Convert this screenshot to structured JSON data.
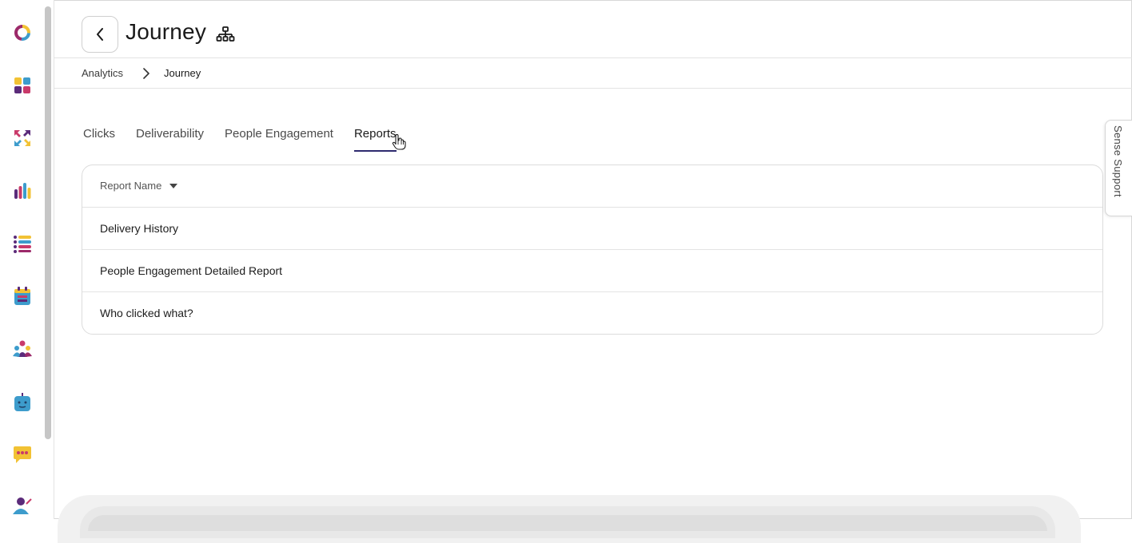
{
  "header": {
    "title": "Journey"
  },
  "breadcrumb": {
    "items": [
      "Analytics",
      "Journey"
    ]
  },
  "tabs": [
    {
      "label": "Clicks",
      "active": false
    },
    {
      "label": "Deliverability",
      "active": false
    },
    {
      "label": "People Engagement",
      "active": false
    },
    {
      "label": "Reports",
      "active": true
    }
  ],
  "table": {
    "column_header": "Report Name",
    "rows": [
      "Delivery History",
      "People Engagement Detailed Report",
      "Who clicked what?"
    ]
  },
  "support_tab": {
    "label": "Sense Support"
  },
  "sidebar": {
    "icons": [
      "logo-icon",
      "dashboard-icon",
      "integrations-icon",
      "analytics-icon",
      "lists-icon",
      "calendar-icon",
      "audience-icon",
      "bot-icon",
      "messages-icon",
      "profile-icon"
    ]
  },
  "colors": {
    "accent": "#2d2a6e",
    "brand_magenta": "#9c2a6a",
    "brand_yellow": "#f2c234",
    "brand_blue": "#3d9ccc",
    "brand_purple": "#5b2b7a"
  }
}
